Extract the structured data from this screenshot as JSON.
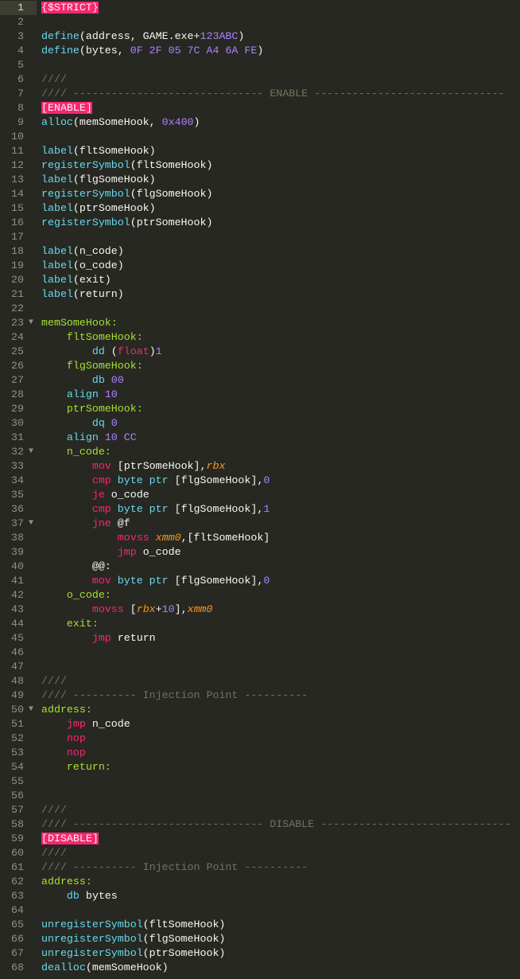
{
  "editor": {
    "theme_colors": {
      "background": "#272822",
      "keyword": "#F92672",
      "function": "#66D9EF",
      "number": "#AE81FF",
      "label": "#A6E22E",
      "register": "#FD971F",
      "comment": "#75715E",
      "text": "#F8F8F2"
    },
    "current_line": 1,
    "fold_icon": "triangle-down-icon",
    "lines": [
      {
        "n": "1",
        "t": [
          [
            "h",
            "{$STRICT}"
          ]
        ]
      },
      {
        "n": "2",
        "t": []
      },
      {
        "n": "3",
        "t": [
          [
            "f",
            "define"
          ],
          [
            "t",
            "(address, GAME.exe+"
          ],
          [
            "n",
            "123ABC"
          ],
          [
            "t",
            ")"
          ]
        ]
      },
      {
        "n": "4",
        "t": [
          [
            "f",
            "define"
          ],
          [
            "t",
            "(bytes, "
          ],
          [
            "n",
            "0F 2F 05 7C A4 6A FE"
          ],
          [
            "t",
            ")"
          ]
        ]
      },
      {
        "n": "5",
        "t": []
      },
      {
        "n": "6",
        "t": [
          [
            "c",
            "////"
          ]
        ]
      },
      {
        "n": "7",
        "t": [
          [
            "c",
            "//// ------------------------------ ENABLE ------------------------------"
          ]
        ]
      },
      {
        "n": "8",
        "t": [
          [
            "h",
            "[ENABLE]"
          ]
        ]
      },
      {
        "n": "9",
        "t": [
          [
            "f",
            "alloc"
          ],
          [
            "t",
            "(memSomeHook, "
          ],
          [
            "n",
            "0x400"
          ],
          [
            "t",
            ")"
          ]
        ]
      },
      {
        "n": "10",
        "t": []
      },
      {
        "n": "11",
        "t": [
          [
            "f",
            "label"
          ],
          [
            "t",
            "(fltSomeHook)"
          ]
        ]
      },
      {
        "n": "12",
        "t": [
          [
            "f",
            "registerSymbol"
          ],
          [
            "t",
            "(fltSomeHook)"
          ]
        ]
      },
      {
        "n": "13",
        "t": [
          [
            "f",
            "label"
          ],
          [
            "t",
            "(flgSomeHook)"
          ]
        ]
      },
      {
        "n": "14",
        "t": [
          [
            "f",
            "registerSymbol"
          ],
          [
            "t",
            "(flgSomeHook)"
          ]
        ]
      },
      {
        "n": "15",
        "t": [
          [
            "f",
            "label"
          ],
          [
            "t",
            "(ptrSomeHook)"
          ]
        ]
      },
      {
        "n": "16",
        "t": [
          [
            "f",
            "registerSymbol"
          ],
          [
            "t",
            "(ptrSomeHook)"
          ]
        ]
      },
      {
        "n": "17",
        "t": []
      },
      {
        "n": "18",
        "t": [
          [
            "f",
            "label"
          ],
          [
            "t",
            "(n_code)"
          ]
        ]
      },
      {
        "n": "19",
        "t": [
          [
            "f",
            "label"
          ],
          [
            "t",
            "(o_code)"
          ]
        ]
      },
      {
        "n": "20",
        "t": [
          [
            "f",
            "label"
          ],
          [
            "t",
            "(exit)"
          ]
        ]
      },
      {
        "n": "21",
        "t": [
          [
            "f",
            "label"
          ],
          [
            "t",
            "(return)"
          ]
        ]
      },
      {
        "n": "22",
        "t": []
      },
      {
        "n": "23",
        "fold": true,
        "t": [
          [
            "l",
            "memSomeHook:"
          ]
        ]
      },
      {
        "n": "24",
        "t": [
          [
            "t",
            "    "
          ],
          [
            "l",
            "fltSomeHook:"
          ]
        ]
      },
      {
        "n": "25",
        "t": [
          [
            "t",
            "        "
          ],
          [
            "f",
            "dd"
          ],
          [
            "t",
            " ("
          ],
          [
            "k",
            "float"
          ],
          [
            "t",
            ")"
          ],
          [
            "n",
            "1"
          ]
        ]
      },
      {
        "n": "26",
        "t": [
          [
            "t",
            "    "
          ],
          [
            "l",
            "flgSomeHook:"
          ]
        ]
      },
      {
        "n": "27",
        "t": [
          [
            "t",
            "        "
          ],
          [
            "f",
            "db"
          ],
          [
            "t",
            " "
          ],
          [
            "n",
            "00"
          ]
        ]
      },
      {
        "n": "28",
        "t": [
          [
            "t",
            "    "
          ],
          [
            "f",
            "align"
          ],
          [
            "t",
            " "
          ],
          [
            "n",
            "10"
          ]
        ]
      },
      {
        "n": "29",
        "t": [
          [
            "t",
            "    "
          ],
          [
            "l",
            "ptrSomeHook:"
          ]
        ]
      },
      {
        "n": "30",
        "t": [
          [
            "t",
            "        "
          ],
          [
            "f",
            "dq"
          ],
          [
            "t",
            " "
          ],
          [
            "n",
            "0"
          ]
        ]
      },
      {
        "n": "31",
        "t": [
          [
            "t",
            "    "
          ],
          [
            "f",
            "align"
          ],
          [
            "t",
            " "
          ],
          [
            "n",
            "10 CC"
          ]
        ]
      },
      {
        "n": "32",
        "fold": true,
        "t": [
          [
            "t",
            "    "
          ],
          [
            "l",
            "n_code:"
          ]
        ]
      },
      {
        "n": "33",
        "t": [
          [
            "t",
            "        "
          ],
          [
            "k",
            "mov"
          ],
          [
            "t",
            " [ptrSomeHook],"
          ],
          [
            "o",
            "rbx"
          ]
        ]
      },
      {
        "n": "34",
        "t": [
          [
            "t",
            "        "
          ],
          [
            "k",
            "cmp"
          ],
          [
            "f",
            " byte ptr"
          ],
          [
            "t",
            " [flgSomeHook],"
          ],
          [
            "n",
            "0"
          ]
        ]
      },
      {
        "n": "35",
        "t": [
          [
            "t",
            "        "
          ],
          [
            "k",
            "je"
          ],
          [
            "t",
            " o_code"
          ]
        ]
      },
      {
        "n": "36",
        "t": [
          [
            "t",
            "        "
          ],
          [
            "k",
            "cmp"
          ],
          [
            "f",
            " byte ptr"
          ],
          [
            "t",
            " [flgSomeHook],"
          ],
          [
            "n",
            "1"
          ]
        ]
      },
      {
        "n": "37",
        "fold": true,
        "t": [
          [
            "t",
            "        "
          ],
          [
            "k",
            "jne"
          ],
          [
            "t",
            " @f"
          ]
        ]
      },
      {
        "n": "38",
        "t": [
          [
            "t",
            "            "
          ],
          [
            "k",
            "movss"
          ],
          [
            "o",
            " xmm0"
          ],
          [
            "t",
            ",[fltSomeHook]"
          ]
        ]
      },
      {
        "n": "39",
        "t": [
          [
            "t",
            "            "
          ],
          [
            "k",
            "jmp"
          ],
          [
            "t",
            " o_code"
          ]
        ]
      },
      {
        "n": "40",
        "t": [
          [
            "t",
            "        @@:"
          ]
        ]
      },
      {
        "n": "41",
        "t": [
          [
            "t",
            "        "
          ],
          [
            "k",
            "mov"
          ],
          [
            "f",
            " byte ptr"
          ],
          [
            "t",
            " [flgSomeHook],"
          ],
          [
            "n",
            "0"
          ]
        ]
      },
      {
        "n": "42",
        "t": [
          [
            "t",
            "    "
          ],
          [
            "l",
            "o_code:"
          ]
        ]
      },
      {
        "n": "43",
        "t": [
          [
            "t",
            "        "
          ],
          [
            "k",
            "movss"
          ],
          [
            "t",
            " ["
          ],
          [
            "o",
            "rbx"
          ],
          [
            "t",
            "+"
          ],
          [
            "n",
            "10"
          ],
          [
            "t",
            "],"
          ],
          [
            "o",
            "xmm0"
          ]
        ]
      },
      {
        "n": "44",
        "t": [
          [
            "t",
            "    "
          ],
          [
            "l",
            "exit:"
          ]
        ]
      },
      {
        "n": "45",
        "t": [
          [
            "t",
            "        "
          ],
          [
            "k",
            "jmp"
          ],
          [
            "t",
            " return"
          ]
        ]
      },
      {
        "n": "46",
        "t": []
      },
      {
        "n": "47",
        "t": []
      },
      {
        "n": "48",
        "t": [
          [
            "c",
            "////"
          ]
        ]
      },
      {
        "n": "49",
        "t": [
          [
            "c",
            "//// ---------- Injection Point ----------"
          ]
        ]
      },
      {
        "n": "50",
        "fold": true,
        "t": [
          [
            "l",
            "address:"
          ]
        ]
      },
      {
        "n": "51",
        "t": [
          [
            "t",
            "    "
          ],
          [
            "k",
            "jmp"
          ],
          [
            "t",
            " n_code"
          ]
        ]
      },
      {
        "n": "52",
        "t": [
          [
            "t",
            "    "
          ],
          [
            "k",
            "nop"
          ]
        ]
      },
      {
        "n": "53",
        "t": [
          [
            "t",
            "    "
          ],
          [
            "k",
            "nop"
          ]
        ]
      },
      {
        "n": "54",
        "t": [
          [
            "t",
            "    "
          ],
          [
            "l",
            "return:"
          ]
        ]
      },
      {
        "n": "55",
        "t": []
      },
      {
        "n": "56",
        "t": []
      },
      {
        "n": "57",
        "t": [
          [
            "c",
            "////"
          ]
        ]
      },
      {
        "n": "58",
        "t": [
          [
            "c",
            "//// ------------------------------ DISABLE ------------------------------"
          ]
        ]
      },
      {
        "n": "59",
        "t": [
          [
            "h",
            "[DISABLE]"
          ]
        ]
      },
      {
        "n": "60",
        "t": [
          [
            "c",
            "////"
          ]
        ]
      },
      {
        "n": "61",
        "t": [
          [
            "c",
            "//// ---------- Injection Point ----------"
          ]
        ]
      },
      {
        "n": "62",
        "t": [
          [
            "l",
            "address:"
          ]
        ]
      },
      {
        "n": "63",
        "t": [
          [
            "t",
            "    "
          ],
          [
            "f",
            "db"
          ],
          [
            "t",
            " bytes"
          ]
        ]
      },
      {
        "n": "64",
        "t": []
      },
      {
        "n": "65",
        "t": [
          [
            "f",
            "unregisterSymbol"
          ],
          [
            "t",
            "(fltSomeHook)"
          ]
        ]
      },
      {
        "n": "66",
        "t": [
          [
            "f",
            "unregisterSymbol"
          ],
          [
            "t",
            "(flgSomeHook)"
          ]
        ]
      },
      {
        "n": "67",
        "t": [
          [
            "f",
            "unregisterSymbol"
          ],
          [
            "t",
            "(ptrSomeHook)"
          ]
        ]
      },
      {
        "n": "68",
        "t": [
          [
            "f",
            "dealloc"
          ],
          [
            "t",
            "(memSomeHook)"
          ]
        ]
      }
    ]
  }
}
